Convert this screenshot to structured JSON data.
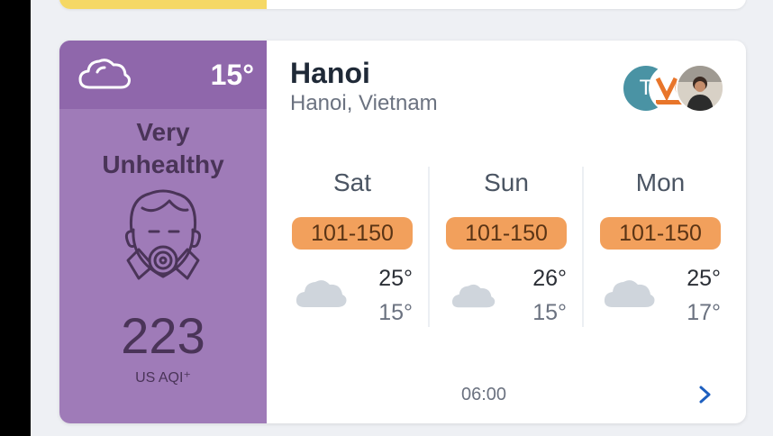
{
  "colors": {
    "aqi_panel": "#9f7bb8",
    "aqi_header": "#8f67ab",
    "badge": "#f2a05c",
    "accent": "#1d5fbf"
  },
  "aqi": {
    "weather_icon": "cloud-icon",
    "temperature": "15°",
    "level_line1": "Very",
    "level_line2": "Unhealthy",
    "icon": "gas-mask-icon",
    "value": "223",
    "unit": "US AQI⁺"
  },
  "location": {
    "city": "Hanoi",
    "region": "Hanoi, Vietnam"
  },
  "avatars": [
    {
      "initial": "T"
    },
    {
      "initial": ""
    },
    {
      "initial": ""
    }
  ],
  "forecast": [
    {
      "day": "Sat",
      "aqi_range": "101-150",
      "icon": "cloud-icon",
      "high": "25°",
      "low": "15°"
    },
    {
      "day": "Sun",
      "aqi_range": "101-150",
      "icon": "cloud-icon",
      "high": "26°",
      "low": "15°"
    },
    {
      "day": "Mon",
      "aqi_range": "101-150",
      "icon": "cloud-icon",
      "high": "25°",
      "low": "17°"
    }
  ],
  "footer": {
    "time": "06:00",
    "next_icon": "chevron-right-icon"
  }
}
